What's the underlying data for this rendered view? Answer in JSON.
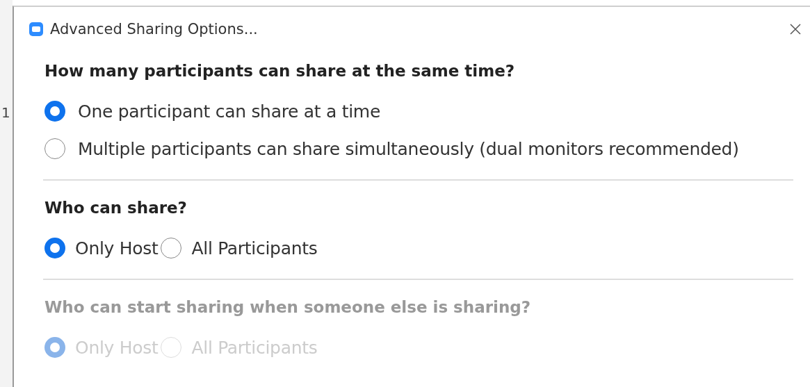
{
  "background_text": "1",
  "window": {
    "title": "Advanced Sharing Options..."
  },
  "sections": [
    {
      "heading": "How many participants can share at the same time?",
      "kind": "stacked",
      "disabled": false,
      "options": [
        {
          "label": "One participant can share at a time",
          "selected": true
        },
        {
          "label": "Multiple participants can share simultaneously (dual monitors recommended)",
          "selected": false
        }
      ]
    },
    {
      "heading": "Who can share?",
      "kind": "inline",
      "disabled": false,
      "options": [
        {
          "label": "Only Host",
          "selected": true
        },
        {
          "label": "All Participants",
          "selected": false
        }
      ]
    },
    {
      "heading": "Who can start sharing when someone else is sharing?",
      "kind": "inline",
      "disabled": true,
      "options": [
        {
          "label": "Only Host",
          "selected": true
        },
        {
          "label": "All Participants",
          "selected": false
        }
      ]
    }
  ]
}
